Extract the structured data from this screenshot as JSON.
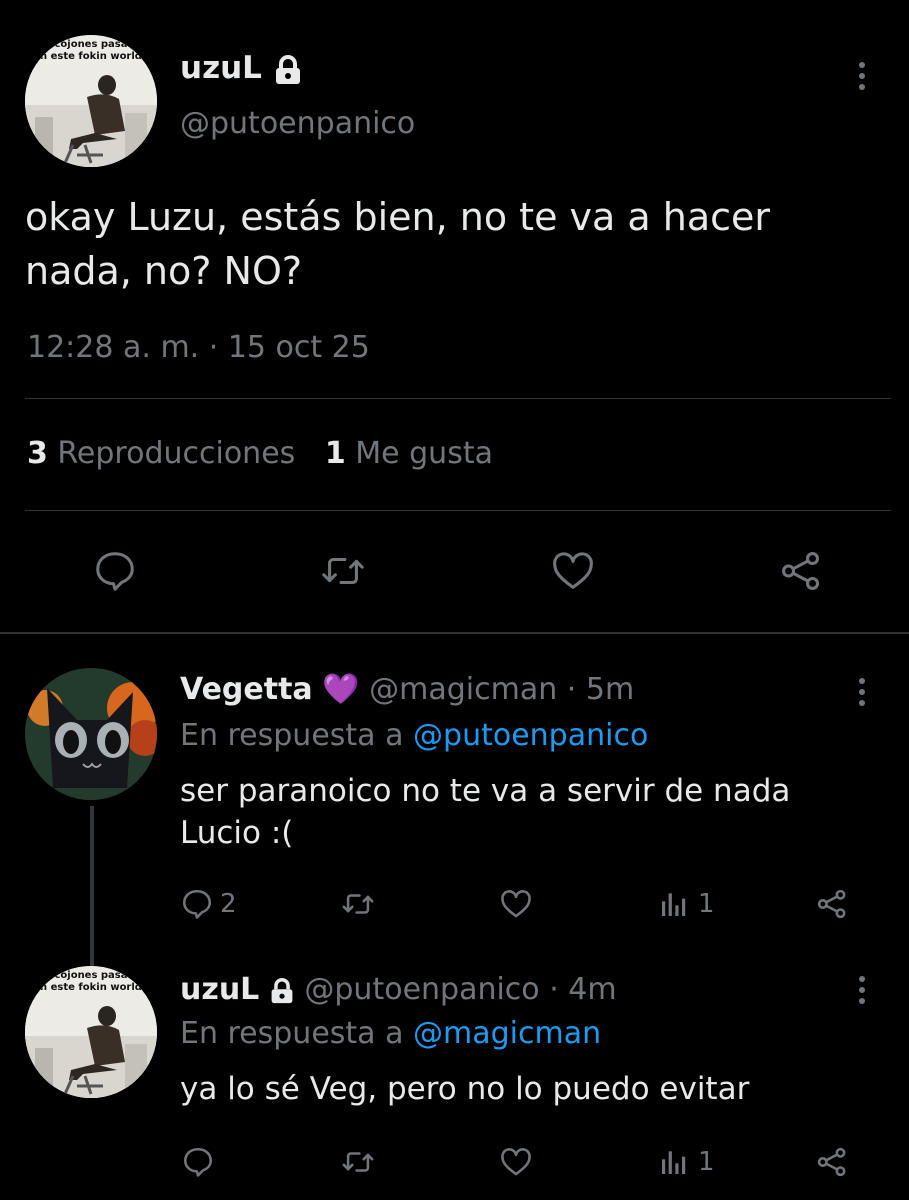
{
  "main_tweet": {
    "display_name": "uzuL",
    "handle": "@putoenpanico",
    "avatar_caption_line1": "cojones pasa",
    "avatar_caption_line2": "n este fokin world",
    "text_line1": "okay Luzu, estás bien, no te va a hacer",
    "text_line2": "nada, no? NO?",
    "timestamp": "12:28 a. m. · 15 oct 25",
    "views_count": "3",
    "views_label": "Reproducciones",
    "likes_count": "1",
    "likes_label": "Me gusta"
  },
  "replies": [
    {
      "display_name": "Vegetta",
      "emoji": "💜",
      "handle": "@magicman",
      "time": "· 5m",
      "reply_prefix": "En respuesta a",
      "reply_to": "@putoenpanico",
      "text_line1": "ser paranoico no te va a servir de nada",
      "text_line2": "Lucio :(",
      "reply_count": "2",
      "view_count": "1"
    },
    {
      "display_name": "uzuL",
      "handle": "@putoenpanico",
      "time": "· 4m",
      "reply_prefix": "En respuesta a",
      "reply_to": "@magicman",
      "avatar_caption_line1": "cojones pasa",
      "avatar_caption_line2": "n este fokin world",
      "text_line1": "ya lo sé Veg, pero no lo puedo evitar",
      "view_count": "1"
    }
  ],
  "colors": {
    "background": "#000000",
    "text": "#e7e9ea",
    "muted": "#71767b",
    "link": "#1d9bf0",
    "divider": "#2f3336"
  }
}
